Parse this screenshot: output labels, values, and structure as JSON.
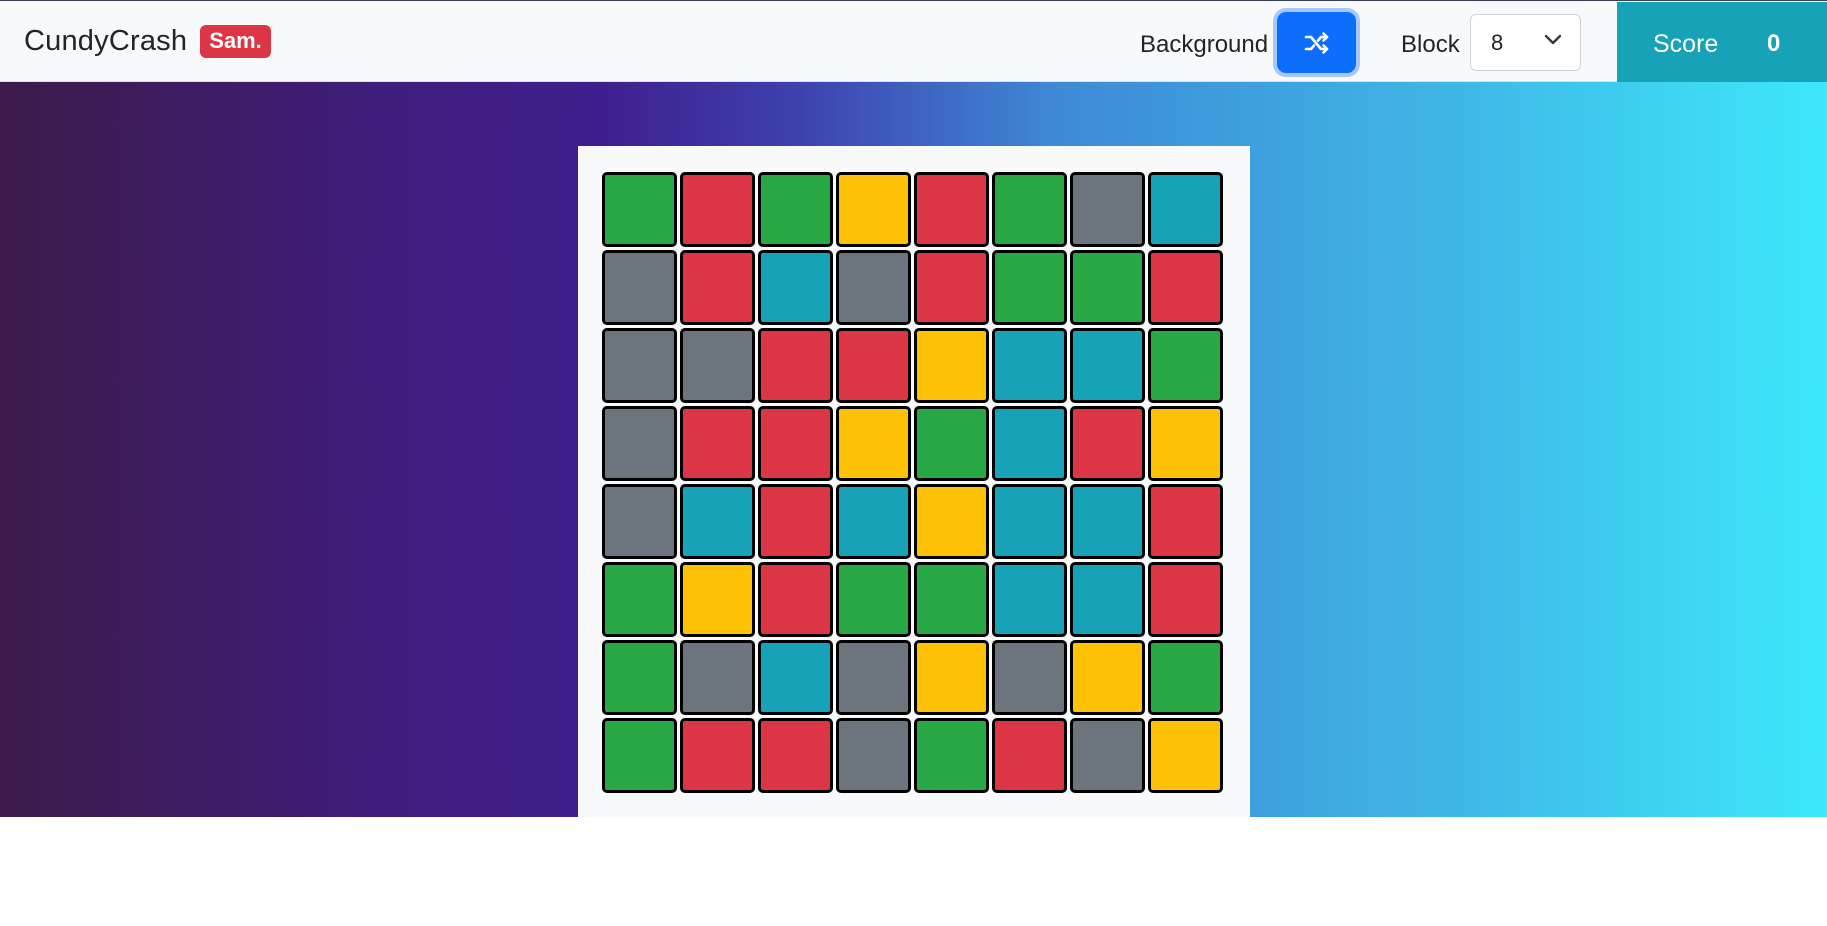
{
  "navbar": {
    "brand": "CundyCrash",
    "badge": "Sam.",
    "background_label": "Background",
    "shuffle_icon": "shuffle-icon",
    "block_label": "Block",
    "block_value": "8",
    "score_label": "Score",
    "score_value": "0"
  },
  "colors": {
    "green": "#28a745",
    "red": "#dc3545",
    "yellow": "#ffc107",
    "gray": "#6c757d",
    "teal": "#17a2b8"
  },
  "board": [
    [
      "green",
      "red",
      "green",
      "yellow",
      "red",
      "green",
      "gray",
      "teal"
    ],
    [
      "gray",
      "red",
      "teal",
      "gray",
      "red",
      "green",
      "green",
      "red"
    ],
    [
      "gray",
      "gray",
      "red",
      "red",
      "yellow",
      "teal",
      "teal",
      "green"
    ],
    [
      "gray",
      "red",
      "red",
      "yellow",
      "green",
      "teal",
      "red",
      "yellow"
    ],
    [
      "gray",
      "teal",
      "red",
      "teal",
      "yellow",
      "teal",
      "teal",
      "red"
    ],
    [
      "green",
      "yellow",
      "red",
      "green",
      "green",
      "teal",
      "teal",
      "red"
    ],
    [
      "green",
      "gray",
      "teal",
      "gray",
      "yellow",
      "gray",
      "yellow",
      "green"
    ],
    [
      "green",
      "red",
      "red",
      "gray",
      "green",
      "red",
      "gray",
      "yellow"
    ]
  ]
}
